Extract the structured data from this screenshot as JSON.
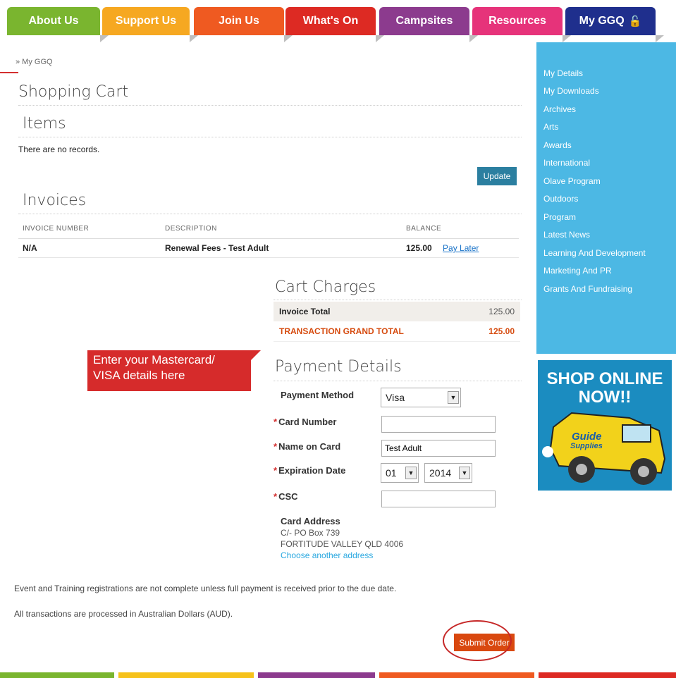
{
  "nav": {
    "tabs": [
      {
        "label": "About Us",
        "color": "#7ab52f"
      },
      {
        "label": "Support Us",
        "color": "#f6a821"
      },
      {
        "label": "Join Us",
        "color": "#ef5a21"
      },
      {
        "label": "What's On",
        "color": "#dd2a23"
      },
      {
        "label": "Campsites",
        "color": "#8c3b8e"
      },
      {
        "label": "Resources",
        "color": "#e6337a"
      },
      {
        "label": "My GGQ",
        "color": "#1f2f8d"
      }
    ]
  },
  "breadcrumb": "» My GGQ",
  "page_title": "Shopping Cart",
  "items": {
    "heading": "Items",
    "empty_text": "There are no records.",
    "update_label": "Update"
  },
  "invoices": {
    "heading": "Invoices",
    "columns": [
      "INVOICE NUMBER",
      "DESCRIPTION",
      "BALANCE"
    ],
    "rows": [
      {
        "number": "N/A",
        "description": "Renewal Fees - Test Adult",
        "balance": "125.00",
        "action": "Pay Later"
      }
    ]
  },
  "cart_charges": {
    "heading": "Cart Charges",
    "invoice_total_label": "Invoice Total",
    "invoice_total_value": "125.00",
    "grand_total_label": "TRANSACTION GRAND TOTAL",
    "grand_total_value": "125.00"
  },
  "payment": {
    "heading": "Payment Details",
    "method_label": "Payment Method",
    "method_value": "Visa",
    "card_number_label": "Card Number",
    "card_number_value": "",
    "name_label": "Name on Card",
    "name_value": "Test Adult",
    "expiry_label": "Expiration Date",
    "expiry_month": "01",
    "expiry_year": "2014",
    "csc_label": "CSC",
    "csc_value": "",
    "required_mark": "*"
  },
  "card_address": {
    "heading": "Card Address",
    "line1": "C/- PO Box 739",
    "line2": "FORTITUDE VALLEY QLD 4006",
    "change_link": "Choose another address"
  },
  "notes": [
    "Event and Training registrations are not complete unless full payment is received prior to the due date.",
    "All transactions are processed in Australian Dollars (AUD)."
  ],
  "submit_label": "Submit Order",
  "callout": {
    "line1": "Enter your Mastercard/",
    "line2": "VISA details here"
  },
  "sidebar": {
    "items": [
      "My Details",
      "My Downloads",
      "Archives",
      "Arts",
      "Awards",
      "International",
      "Olave Program",
      "Outdoors",
      "Program",
      "Latest News",
      "Learning And Development",
      "Marketing And PR",
      "Grants And Fundraising"
    ]
  },
  "ad": {
    "line1": "SHOP ONLINE",
    "line2": "NOW!!",
    "van_text1": "Guide",
    "van_text2": "Supplies"
  },
  "colors": {
    "update_button": "#2b7fa0",
    "submit_button": "#d9480f",
    "sidebar": "#4cb8e4",
    "accent_red": "#d32f2f"
  }
}
